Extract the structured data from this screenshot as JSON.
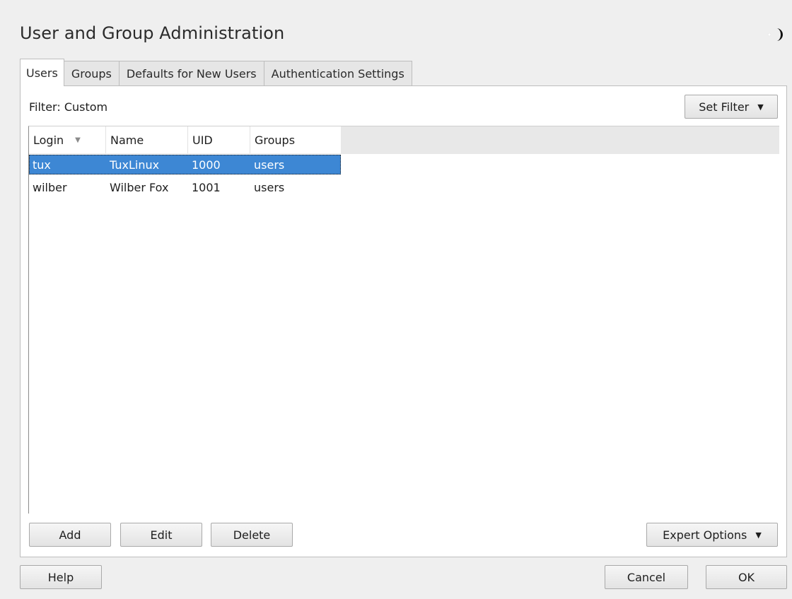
{
  "window": {
    "title": "User and Group Administration",
    "icon": "moon-icon"
  },
  "tabs": [
    {
      "label": "Users",
      "active": true
    },
    {
      "label": "Groups",
      "active": false
    },
    {
      "label": "Defaults for New Users",
      "active": false
    },
    {
      "label": "Authentication Settings",
      "active": false
    }
  ],
  "filter": {
    "label": "Filter: Custom",
    "set_filter_button": "Set Filter"
  },
  "table": {
    "columns": [
      "Login",
      "Name",
      "UID",
      "Groups"
    ],
    "sort_column": "Login",
    "rows": [
      {
        "login": "tux",
        "name": "TuxLinux",
        "uid": "1000",
        "groups": "users",
        "selected": true
      },
      {
        "login": "wilber",
        "name": "Wilber Fox",
        "uid": "1001",
        "groups": "users",
        "selected": false
      }
    ]
  },
  "actions": {
    "add": "Add",
    "edit": "Edit",
    "delete": "Delete",
    "expert_options": "Expert Options"
  },
  "footer": {
    "help": "Help",
    "cancel": "Cancel",
    "ok": "OK"
  },
  "colors": {
    "selection": "#3d87d4",
    "background": "#efefef",
    "panel": "#ffffff"
  }
}
